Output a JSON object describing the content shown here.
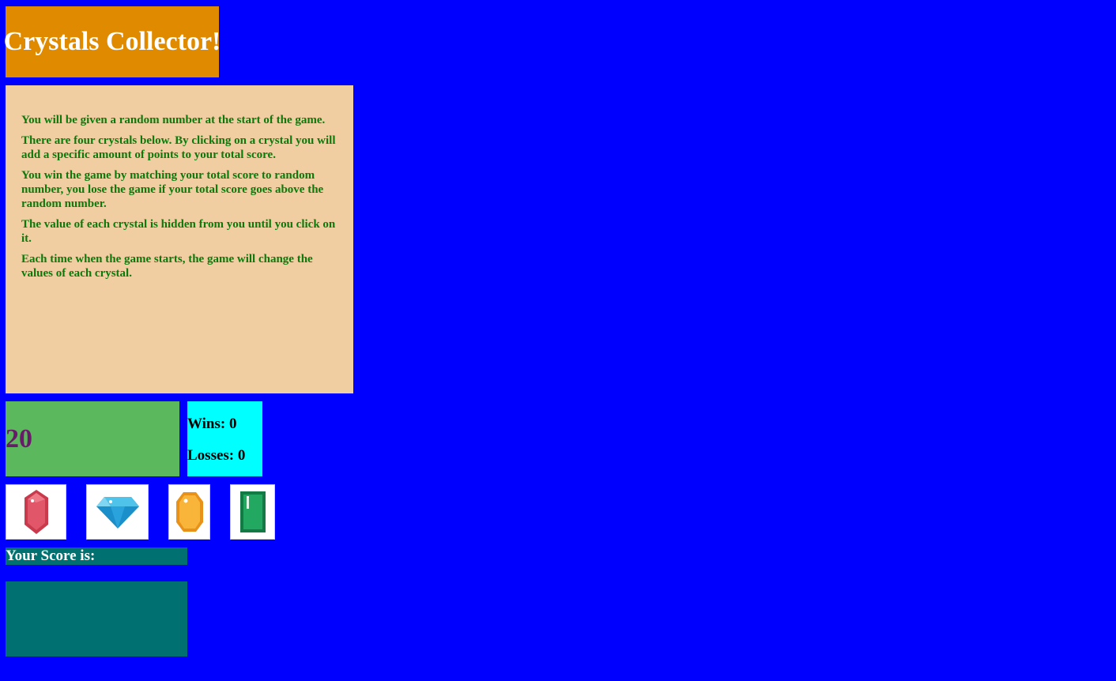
{
  "header": {
    "title": "Crystals Collector!"
  },
  "instructions": {
    "paragraphs": [
      "You will be given a random number at the start of the game.",
      "There are four crystals below. By clicking on a crystal you will add a specific amount of points to your total score.",
      "You win the game by matching your total score to random number, you lose the game if your total score goes above the random number.",
      "The value of each crystal is hidden from you until you click on it.",
      "Each time when the game starts, the game will change the values of each crystal."
    ]
  },
  "game": {
    "random_number": "20",
    "wins_text": "Wins: 0",
    "losses_text": "Losses: 0",
    "score_label": "Your Score is:",
    "score_value": ""
  },
  "crystals": [
    {
      "icon": "red-crystal-icon",
      "color": "#d94b5e"
    },
    {
      "icon": "blue-diamond-icon",
      "color": "#27a9dc"
    },
    {
      "icon": "yellow-crystal-icon",
      "color": "#f6ae2d"
    },
    {
      "icon": "green-emerald-icon",
      "color": "#1f9a5a"
    }
  ],
  "colors": {
    "background": "#0000ff",
    "title_bg": "#e08a00",
    "instructions_bg": "#f0cea2",
    "instructions_text": "#0a7a0a",
    "target_bg": "#5cb85c",
    "target_text": "#6a1a6a",
    "stats_bg": "#00ffff",
    "score_bg": "#007070"
  }
}
